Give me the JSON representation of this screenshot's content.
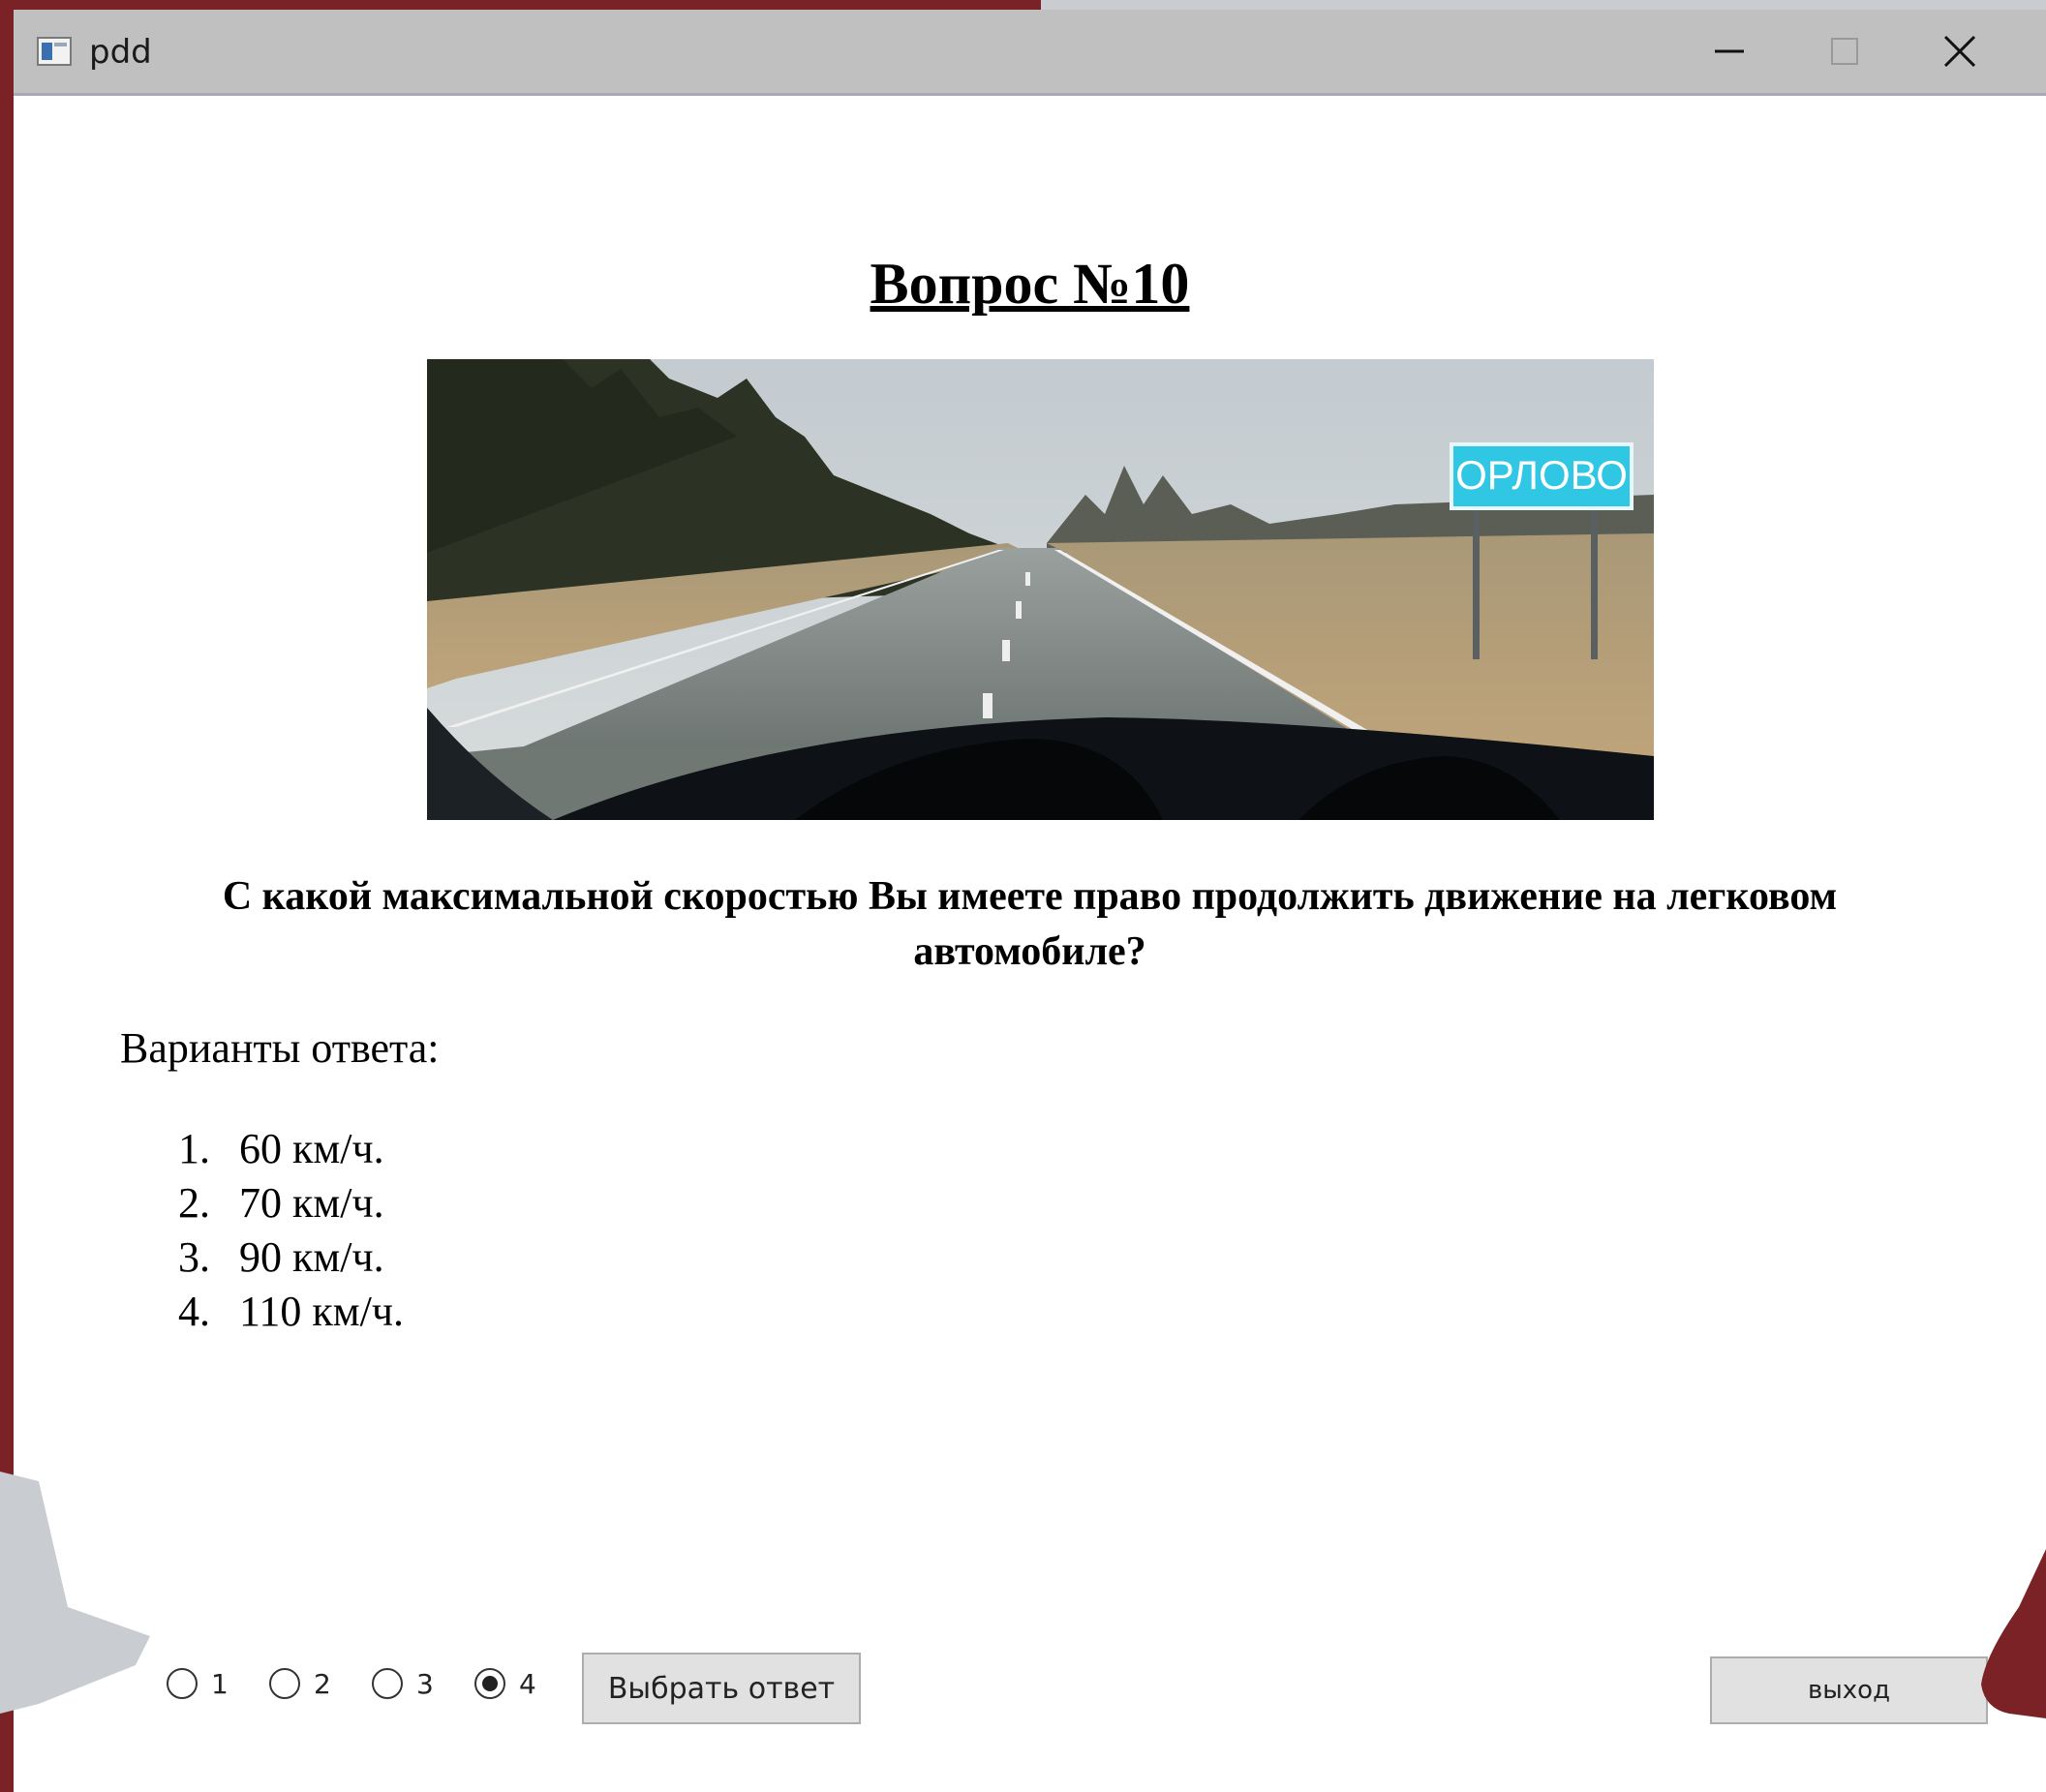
{
  "window": {
    "title": "pdd"
  },
  "question": {
    "title": "Вопрос №10",
    "image_sign_text": "ОРЛОВО",
    "text": "С какой максимальной скоростью Вы имеете право продолжить движение на легковом автомобиле?",
    "answers_label": "Варианты ответа:",
    "answers": [
      {
        "num": "1.",
        "text": "60 км/ч."
      },
      {
        "num": "2.",
        "text": "70 км/ч."
      },
      {
        "num": "3.",
        "text": "90 км/ч."
      },
      {
        "num": "4.",
        "text": "110 км/ч."
      }
    ]
  },
  "controls": {
    "radios": [
      {
        "label": "1",
        "checked": false
      },
      {
        "label": "2",
        "checked": false
      },
      {
        "label": "3",
        "checked": false
      },
      {
        "label": "4",
        "checked": true
      }
    ],
    "submit_label": "Выбрать ответ",
    "exit_label": "выход"
  },
  "colors": {
    "slide_accent": "#7b2227",
    "slide_grey": "#c9ccd0",
    "titlebar": "#c0c0c0",
    "sign_background": "#2fc7e3"
  }
}
